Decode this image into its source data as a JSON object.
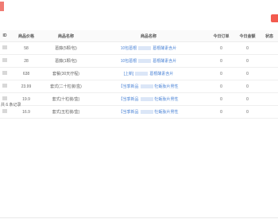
{
  "columns": [
    "ID",
    "商品价格",
    "商品名称",
    "商品名称",
    "今日订单",
    "今日金额",
    "状态"
  ],
  "rows": [
    {
      "price": "58",
      "name": "葛藤(5颗/包)",
      "product_pre": "10包葛根",
      "product_post": "葛根酵素含片",
      "today_orders": "0",
      "today_amount": "0"
    },
    {
      "price": "28",
      "name": "葛藤(1颗/包)",
      "product_pre": "10包葛根",
      "product_post": "葛根酵素含片",
      "today_orders": "0",
      "today_amount": "0"
    },
    {
      "price": "638",
      "name": "套餐(30天疗程)",
      "product_pre": "[上新]",
      "product_post": "葛根酵素含片",
      "today_orders": "0",
      "today_amount": "0"
    },
    {
      "price": "23.99",
      "name": "套式(二十粒装/盒)",
      "product_pre": "【当季新品",
      "product_post": "牡蛎肽片男性",
      "today_orders": "0",
      "today_amount": "0"
    },
    {
      "price": "19.9",
      "name": "套式(十粒装/盒)",
      "product_pre": "【当季新品",
      "product_post": "牡蛎肽片男性",
      "today_orders": "0",
      "today_amount": "0"
    },
    {
      "price": "16.9",
      "name": "套式(五粒装/盒)",
      "product_pre": "【当季新品",
      "product_post": "牡蛎肽片男性",
      "today_orders": "0",
      "today_amount": "0"
    }
  ],
  "footer": {
    "total_text": "共 6 条记录"
  }
}
